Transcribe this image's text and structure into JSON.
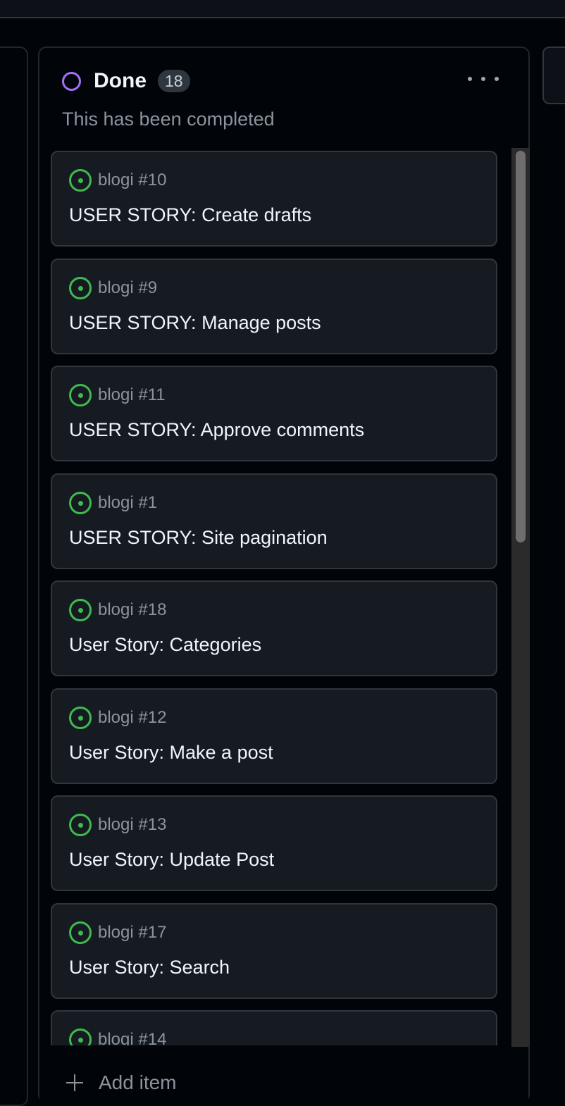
{
  "column": {
    "title": "Done",
    "count": "18",
    "description": "This has been completed",
    "status_color": "#a371f7"
  },
  "cards": [
    {
      "ref": "blogi #10",
      "title": "USER STORY: Create drafts"
    },
    {
      "ref": "blogi #9",
      "title": "USER STORY: Manage posts"
    },
    {
      "ref": "blogi #11",
      "title": "USER STORY: Approve comments"
    },
    {
      "ref": "blogi #1",
      "title": "USER STORY: Site pagination"
    },
    {
      "ref": "blogi #18",
      "title": "User Story: Categories"
    },
    {
      "ref": "blogi #12",
      "title": "User Story: Make a post"
    },
    {
      "ref": "blogi #13",
      "title": "User Story: Update Post"
    },
    {
      "ref": "blogi #17",
      "title": "User Story: Search"
    },
    {
      "ref": "blogi #14",
      "title": ""
    }
  ],
  "footer": {
    "add_label": "Add item"
  },
  "icons": {
    "issue": "issue-open-icon",
    "more": "kebab-horizontal-icon",
    "add": "plus-icon"
  },
  "colors": {
    "issue_open": "#3fb950",
    "background": "#010409",
    "card": "#161b22"
  }
}
